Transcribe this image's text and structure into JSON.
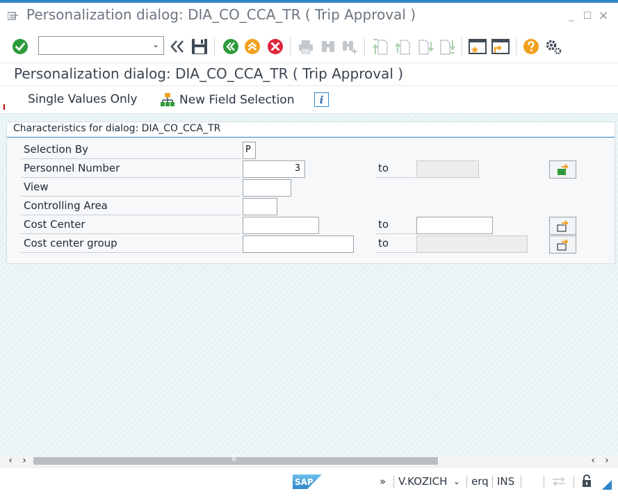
{
  "window": {
    "title": "Personalization dialog: DIA_CO_CCA_TR ( Trip Approval )",
    "min_glyph": "_",
    "max_glyph": "☐",
    "close_glyph": "×"
  },
  "toolbar": {
    "command_field_value": "",
    "icons": [
      "enter-icon",
      "back-double-icon",
      "save-icon",
      "back-icon",
      "exit-icon",
      "cancel-icon",
      "print-icon",
      "find-icon",
      "find-next-icon",
      "first-page-icon",
      "previous-page-icon",
      "next-page-icon",
      "last-page-icon",
      "new-session-icon",
      "shortcut-icon",
      "help-icon",
      "settings-icon"
    ],
    "colors": {
      "green": "#2e9b3a",
      "orange": "#f2a01c",
      "red": "#e0283c",
      "disabled": "#c3c8cd"
    }
  },
  "app": {
    "title": "Personalization dialog: DIA_CO_CCA_TR ( Trip Approval )",
    "buttons": {
      "single_values": "Single Values Only",
      "new_field_selection": "New Field Selection",
      "info_glyph": "i"
    }
  },
  "panel": {
    "header": "Characteristics for dialog: DIA_CO_CCA_TR",
    "to_label": "to",
    "rows": [
      {
        "label": "Selection By",
        "value": "P"
      },
      {
        "label": "Personnel Number",
        "value": "3",
        "to_value": ""
      },
      {
        "label": "View",
        "value": ""
      },
      {
        "label": "Controlling Area",
        "value": ""
      },
      {
        "label": "Cost Center",
        "value": "",
        "to_value": ""
      },
      {
        "label": "Cost center group",
        "value": "",
        "to_value": ""
      }
    ]
  },
  "statusbar": {
    "logo": "SAP",
    "more": "»",
    "user": "V.KOZICH",
    "client": "erq",
    "mode": "INS"
  }
}
